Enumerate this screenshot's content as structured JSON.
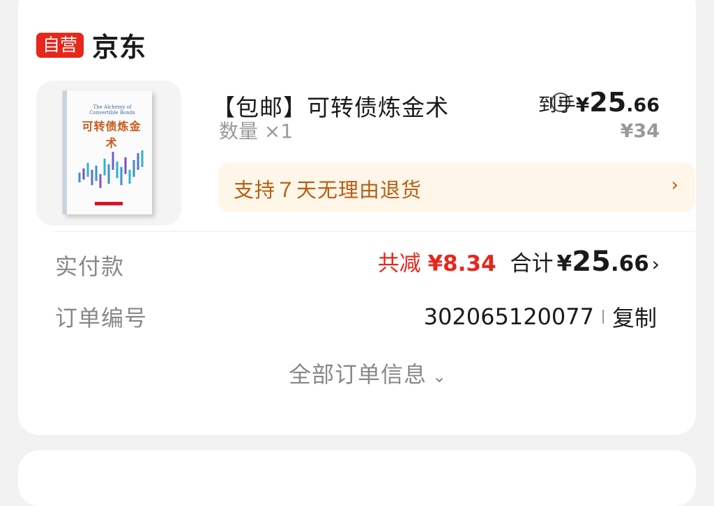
{
  "store": {
    "badge": "自营",
    "name": "京东"
  },
  "product": {
    "title": "【包邮】可转债炼金术",
    "cover_title_cn": "可转债炼金术",
    "cover_title_en": "The Alchemy of Convertible Bonds",
    "final_price_label": "到手",
    "final_price_yen": "¥",
    "final_price_int": "25",
    "final_price_dec": ".66",
    "quantity": "数量 ×1",
    "original_price": "¥34"
  },
  "return_policy": {
    "text": "支持７天无理由退货",
    "chevron": "›"
  },
  "payment": {
    "label": "实付款",
    "discount": "共减 ",
    "discount_amount": "¥8.34",
    "total_label": "合计",
    "total_yen": "¥",
    "total_int": "25",
    "total_dec": ".66",
    "chevron": "›"
  },
  "order": {
    "label": "订单编号",
    "number": "302065120077",
    "copy": "复制"
  },
  "all_info": {
    "label": "全部订单信息",
    "chevron": "⌄"
  },
  "colors": {
    "accent": "#e8261b",
    "return_text": "#b85d10",
    "return_bg": "#fff6ea"
  }
}
